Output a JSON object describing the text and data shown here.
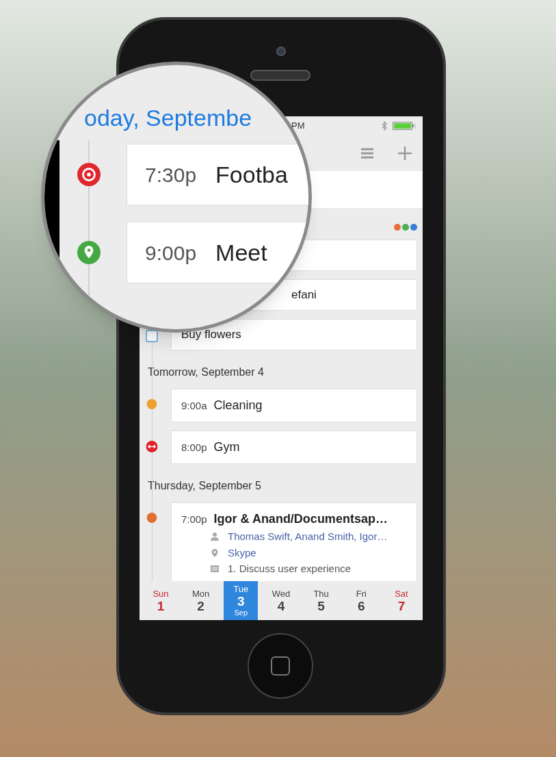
{
  "status_bar": {
    "time": "PM"
  },
  "category_dots": [
    {
      "color": "#e8703a"
    },
    {
      "color": "#4caf50"
    },
    {
      "color": "#3b7dd8"
    }
  ],
  "today_items": [
    {
      "kind": "card"
    },
    {
      "kind": "event",
      "title": "efani"
    },
    {
      "kind": "task",
      "title": "Buy flowers",
      "checked": false
    }
  ],
  "days": [
    {
      "heading": "Tomorrow, September 4",
      "events": [
        {
          "time": "9:00a",
          "title": "Cleaning",
          "kind": "dot",
          "color": "#f0a030"
        },
        {
          "time": "8:00p",
          "title": "Gym",
          "kind": "dumbbell",
          "color": "#e0202a"
        }
      ]
    },
    {
      "heading": "Thursday, September 5",
      "events": [
        {
          "time": "7:00p",
          "title": "Igor & Anand/Documentsap…",
          "kind": "dot",
          "color": "#e07030",
          "details": [
            {
              "kind": "people",
              "text": "Thomas Swift, Anand Smith, Igor…"
            },
            {
              "kind": "location",
              "text": "Skype"
            },
            {
              "kind": "notes",
              "text": "1. Discuss user experience"
            }
          ]
        }
      ]
    }
  ],
  "week_strip": [
    {
      "day": "Sun",
      "date": "1",
      "weekend": true,
      "selected": false
    },
    {
      "day": "Mon",
      "date": "2",
      "weekend": false,
      "selected": false
    },
    {
      "day": "Tue",
      "date": "3",
      "month": "Sep",
      "weekend": false,
      "selected": true
    },
    {
      "day": "Wed",
      "date": "4",
      "weekend": false,
      "selected": false
    },
    {
      "day": "Thu",
      "date": "5",
      "weekend": false,
      "selected": false
    },
    {
      "day": "Fri",
      "date": "6",
      "weekend": false,
      "selected": false
    },
    {
      "day": "Sat",
      "date": "7",
      "weekend": true,
      "selected": false
    }
  ],
  "magnifier": {
    "heading": "oday, Septembe",
    "events": [
      {
        "time": "7:30p",
        "title": "Footba",
        "kind": "ball",
        "color": "#e0262e"
      },
      {
        "time": "9:00p",
        "title": "Meet",
        "kind": "pin",
        "color": "#45a843"
      }
    ]
  }
}
